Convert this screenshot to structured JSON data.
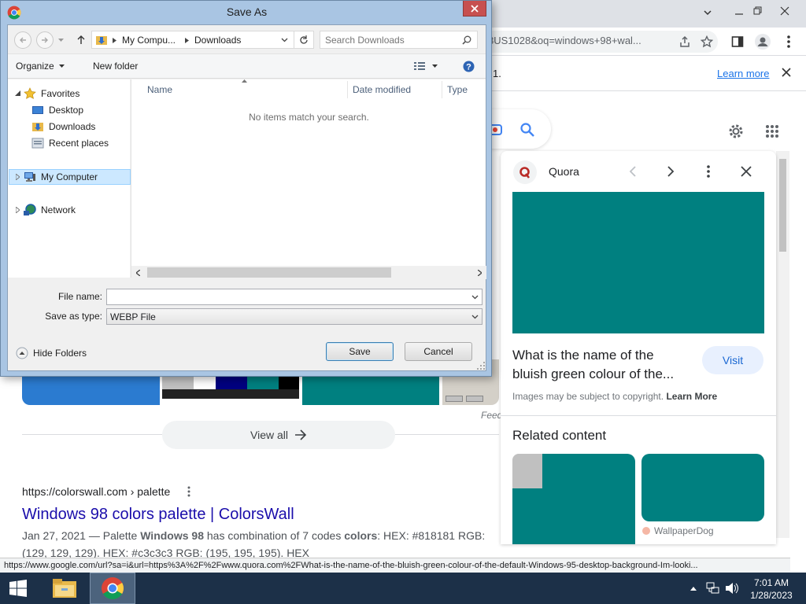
{
  "browser": {
    "url_text": "8US1028&oq=windows+98+wal...",
    "infobar_text": "1.",
    "infobar_link": "Learn more",
    "status_url": "https://www.google.com/url?sa=i&url=https%3A%2F%2Fwww.quora.com%2FWhat-is-the-name-of-the-bluish-green-colour-of-the-default-Windows-95-desktop-background-Im-looki..."
  },
  "results": {
    "feedback": "Feed",
    "view_all": "View all",
    "result_url": "https://colorswall.com › palette",
    "result_title": "Windows 98 colors palette | ColorsWall",
    "snippet_line1_a": "Jan 27, 2021 — Palette ",
    "snippet_bold1": "Windows 98",
    "snippet_line1_b": " has combination of 7 codes ",
    "snippet_bold2": "colors",
    "snippet_line1_c": ": HEX: #818181 RGB:",
    "snippet_line2": "(129, 129, 129). HEX: #c3c3c3 RGB: (195, 195, 195). HEX"
  },
  "panel": {
    "source": "Quora",
    "title_line1": "What is the name of the",
    "title_line2": "bluish green colour of the...",
    "visit": "Visit",
    "copyright": "Images may be subject to copyright. ",
    "learn_more": "Learn More",
    "related": "Related content",
    "related_source": "WallpaperDog"
  },
  "dialog": {
    "title": "Save As",
    "path_1": "My Compu...",
    "path_2": "Downloads",
    "search_placeholder": "Search Downloads",
    "organize": "Organize",
    "new_folder": "New folder",
    "tree": {
      "favorites": "Favorites",
      "desktop": "Desktop",
      "downloads": "Downloads",
      "recent": "Recent places",
      "my_computer": "My Computer",
      "network": "Network"
    },
    "columns": {
      "name": "Name",
      "date": "Date modified",
      "type": "Type"
    },
    "empty": "No items match your search.",
    "file_name_label": "File name:",
    "file_name_value": "",
    "save_type_label": "Save as type:",
    "save_type_value": "WEBP File",
    "hide_folders": "Hide Folders",
    "save": "Save",
    "cancel": "Cancel"
  },
  "taskbar": {
    "time": "7:01 AM",
    "date": "1/28/2023"
  },
  "colors": {
    "teal": "#008080",
    "link_blue": "#1a0dab",
    "dialog_frame": "#a9c5e3",
    "close_red": "#c75050",
    "taskbar": "#1c3048"
  }
}
